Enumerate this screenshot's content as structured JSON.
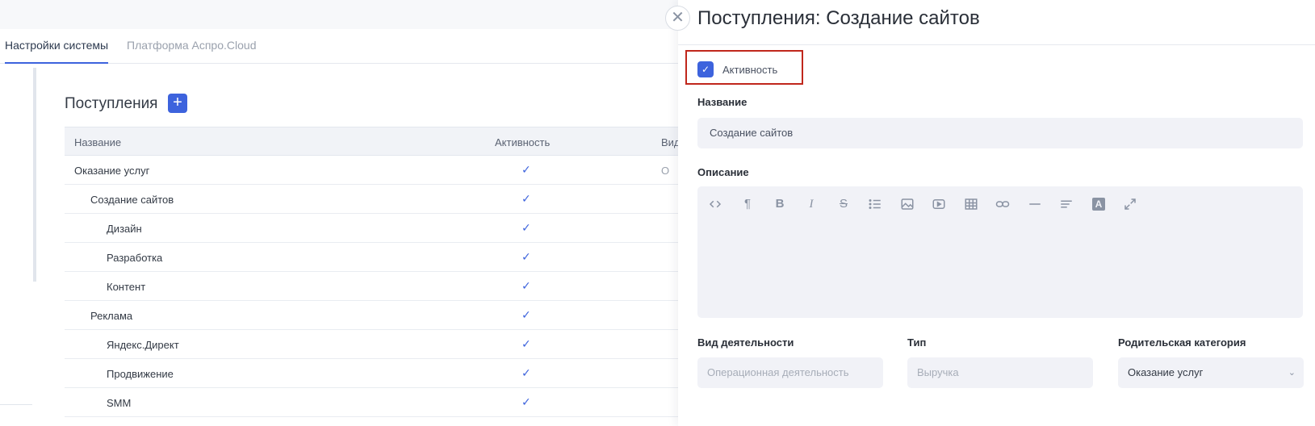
{
  "tabs": [
    {
      "label": "Настройки системы",
      "active": true
    },
    {
      "label": "Платформа Аспро.Cloud",
      "active": false
    }
  ],
  "section": {
    "title": "Поступления",
    "add_label": "+"
  },
  "table": {
    "headers": {
      "name": "Название",
      "active": "Активность",
      "kind": "Вид"
    },
    "rows": [
      {
        "name": "Оказание услуг",
        "level": 0,
        "active": "✓",
        "kind": "О"
      },
      {
        "name": "Создание сайтов",
        "level": 1,
        "active": "✓",
        "kind": ""
      },
      {
        "name": "Дизайн",
        "level": 2,
        "active": "✓",
        "kind": ""
      },
      {
        "name": "Разработка",
        "level": 2,
        "active": "✓",
        "kind": ""
      },
      {
        "name": "Контент",
        "level": 2,
        "active": "✓",
        "kind": ""
      },
      {
        "name": "Реклама",
        "level": 1,
        "active": "✓",
        "kind": ""
      },
      {
        "name": "Яндекс.Директ",
        "level": 2,
        "active": "✓",
        "kind": ""
      },
      {
        "name": "Продвижение",
        "level": 2,
        "active": "✓",
        "kind": ""
      },
      {
        "name": "SMM",
        "level": 2,
        "active": "✓",
        "kind": ""
      }
    ]
  },
  "drawer": {
    "close_label": "✕",
    "title": "Поступления: Создание сайтов",
    "active_checkbox": {
      "label": "Активность",
      "checked": true,
      "mark": "✓"
    },
    "name_field": {
      "label": "Название",
      "value": "Создание сайтов"
    },
    "description": {
      "label": "Описание",
      "toolbar": [
        "code-icon",
        "paragraph-icon",
        "bold-icon",
        "italic-icon",
        "strikethrough-icon",
        "bullet-list-icon",
        "image-icon",
        "video-icon",
        "table-icon",
        "link-icon",
        "horizontal-rule-icon",
        "align-icon",
        "font-color-icon",
        "fullscreen-icon"
      ]
    },
    "kind_field": {
      "label": "Вид деятельности",
      "placeholder": "Операционная деятельность"
    },
    "type_field": {
      "label": "Тип",
      "placeholder": "Выручка"
    },
    "parent_field": {
      "label": "Родительская категория",
      "value": "Оказание услуг",
      "chevron": "⌄"
    }
  },
  "colors": {
    "accent": "#3d63dd",
    "highlight": "#c0271c"
  }
}
